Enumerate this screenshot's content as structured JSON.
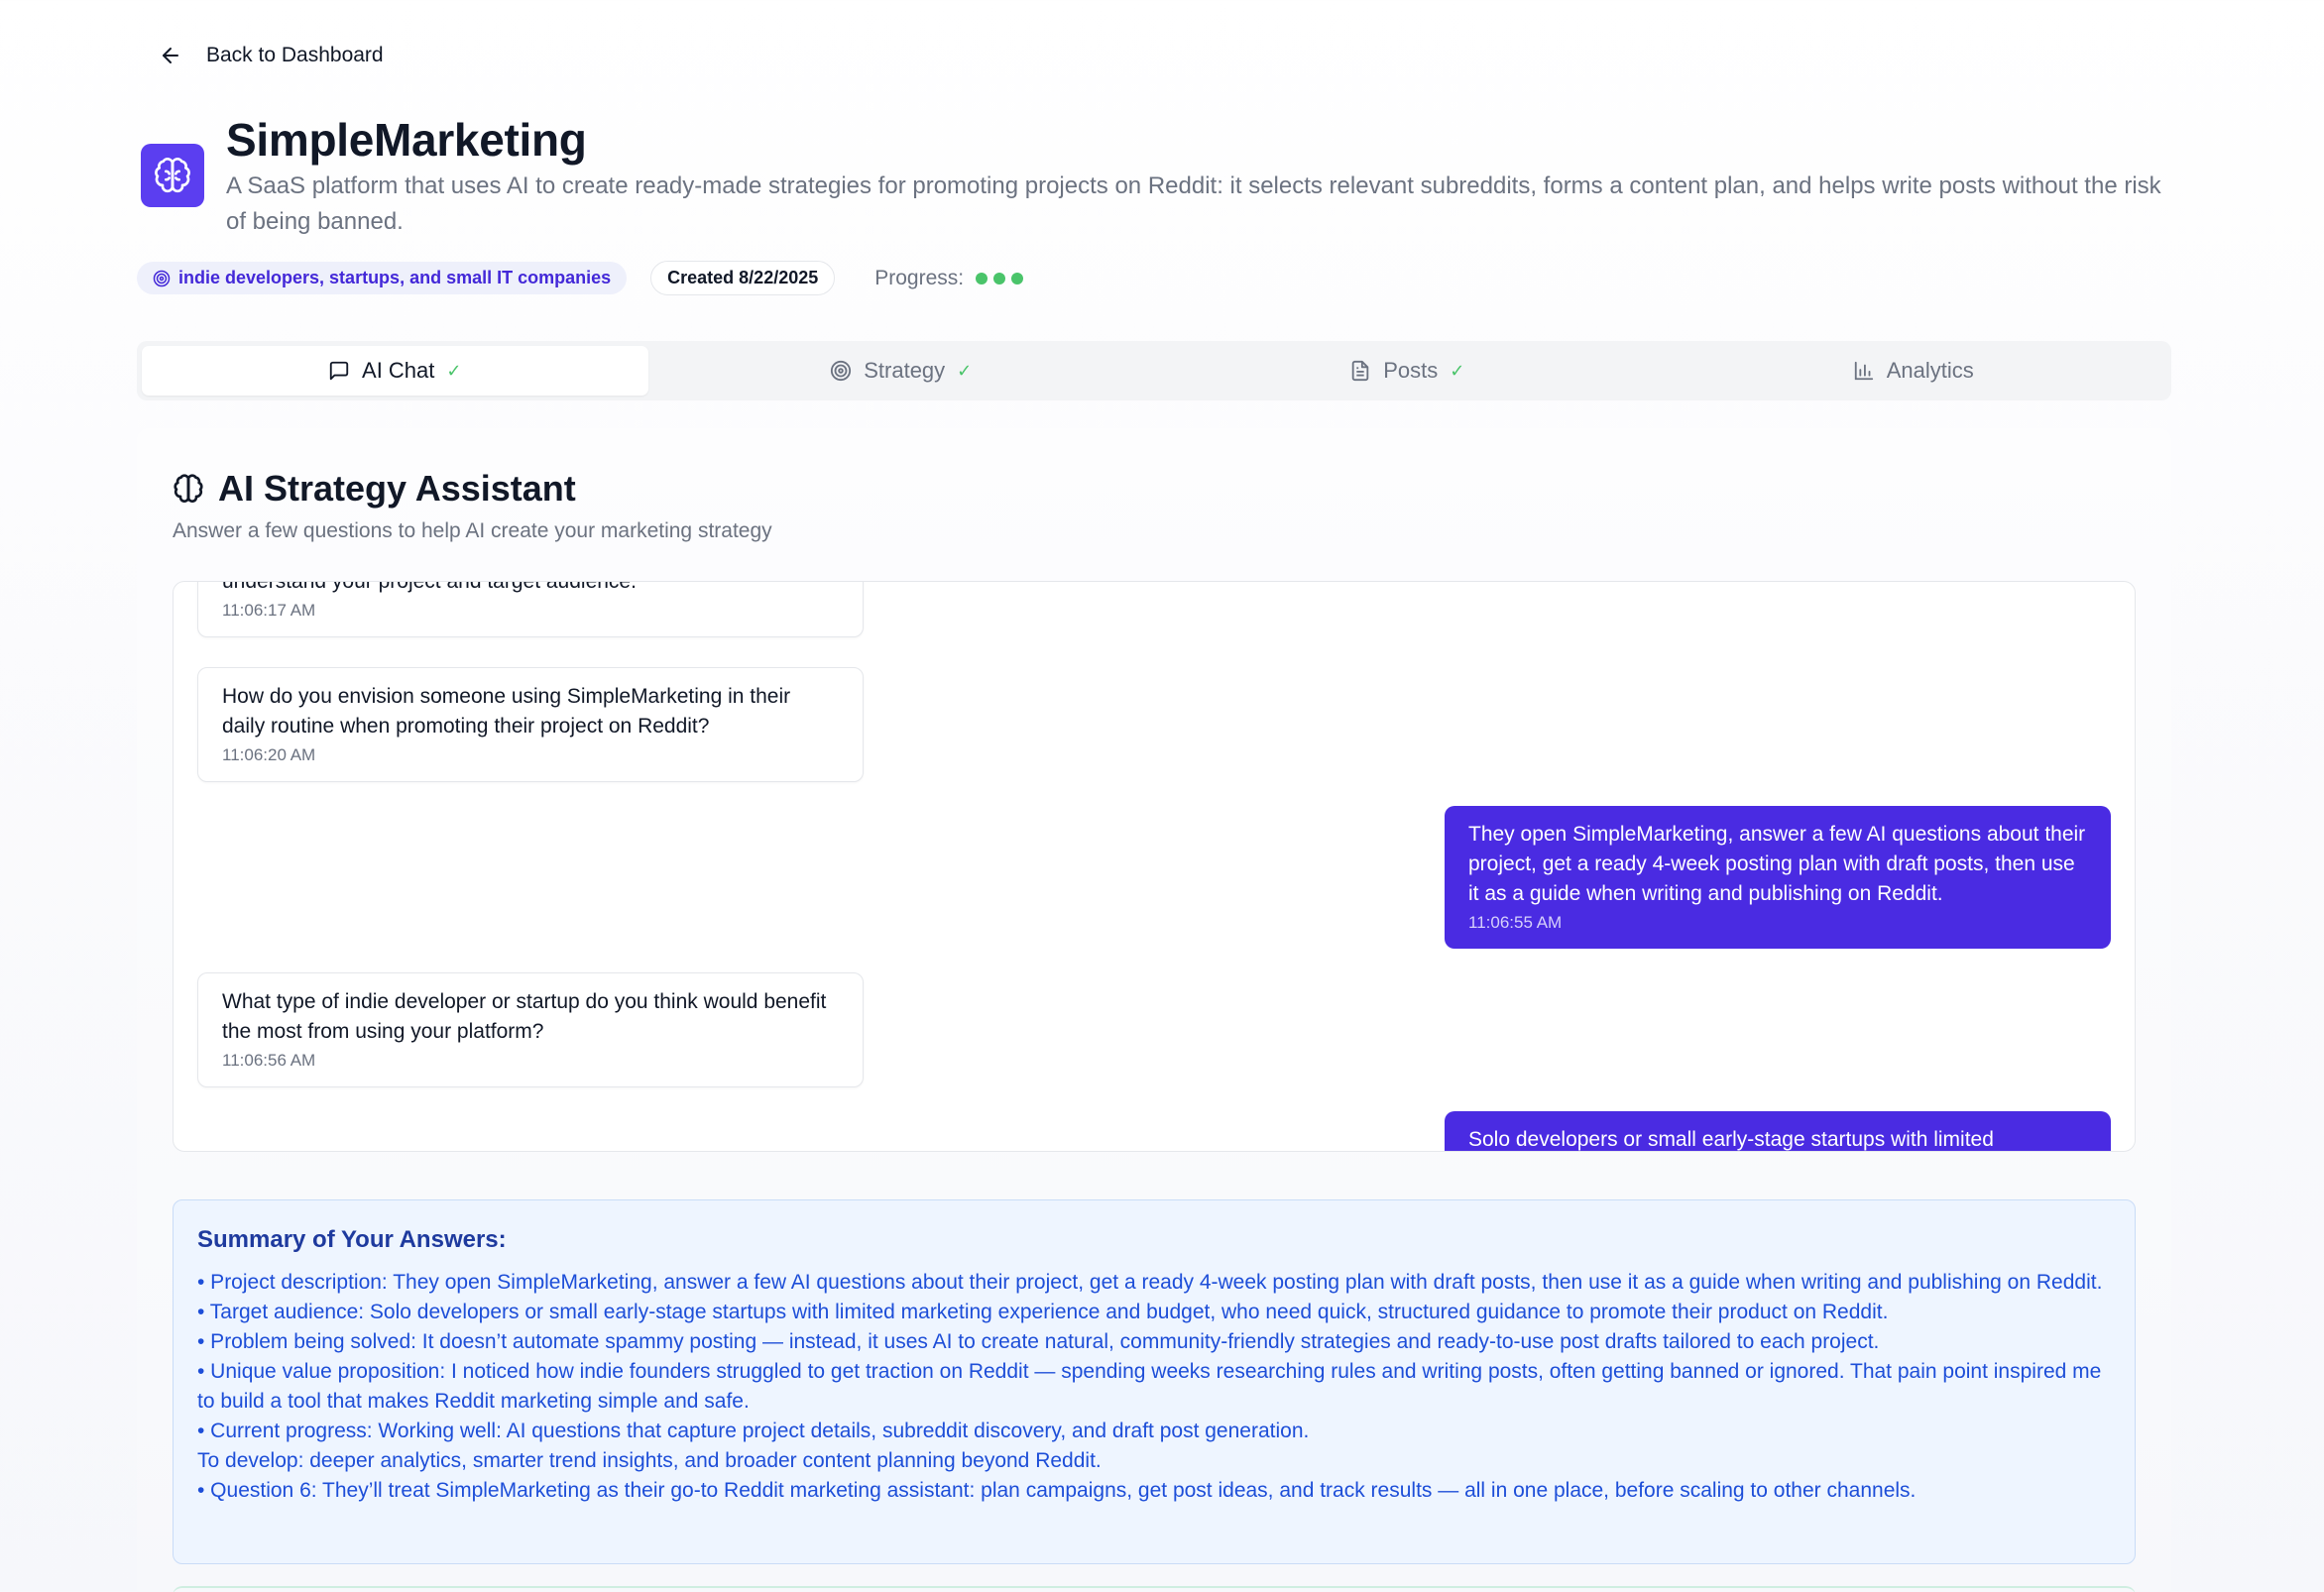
{
  "nav": {
    "back_label": "Back to Dashboard"
  },
  "project": {
    "title": "SimpleMarketing",
    "description": "A SaaS platform that uses AI to create ready-made strategies for promoting projects on Reddit: it selects relevant subreddits, forms a content plan, and helps write posts without the risk of being banned.",
    "audience": "indie developers, startups, and small IT companies",
    "created": "Created 8/22/2025",
    "progress_label": "Progress:",
    "progress_steps_completed": 3,
    "progress_color": "#4ac46a"
  },
  "tabs": [
    {
      "label": "AI Chat",
      "icon": "message-square-icon",
      "done": true,
      "active": true
    },
    {
      "label": "Strategy",
      "icon": "target-icon",
      "done": true,
      "active": false
    },
    {
      "label": "Posts",
      "icon": "file-text-icon",
      "done": true,
      "active": false
    },
    {
      "label": "Analytics",
      "icon": "bar-chart-icon",
      "done": false,
      "active": false
    }
  ],
  "assistant": {
    "title": "AI Strategy Assistant",
    "subtitle": "Answer a few questions to help AI create your marketing strategy"
  },
  "messages": [
    {
      "role": "ai",
      "text": "understand your project and target audience.",
      "time": "11:06:17 AM"
    },
    {
      "role": "ai",
      "text": "How do you envision someone using SimpleMarketing in their daily routine when promoting their project on Reddit?",
      "time": "11:06:20 AM"
    },
    {
      "role": "user",
      "text": "They open SimpleMarketing, answer a few AI questions about their project, get a ready 4-week posting plan with draft posts, then use it as a guide when writing and publishing on Reddit.",
      "time": "11:06:55 AM"
    },
    {
      "role": "ai",
      "text": "What type of indie developer or startup do you think would benefit the most from using your platform?",
      "time": "11:06:56 AM"
    },
    {
      "role": "user",
      "text": "Solo developers or small early-stage startups with limited",
      "time": ""
    }
  ],
  "summary": {
    "title": "Summary of Your Answers:",
    "lines": [
      "• Project description: They open SimpleMarketing, answer a few AI questions about their project, get a ready 4-week posting plan with draft posts, then use it as a guide when writing and publishing on Reddit.",
      "• Target audience: Solo developers or small early-stage startups with limited marketing experience and budget, who need quick, structured guidance to promote their product on Reddit.",
      "• Problem being solved: It doesn’t automate spammy posting — instead, it uses AI to create natural, community-friendly strategies and ready-to-use post drafts tailored to each project.",
      "• Unique value proposition: I noticed how indie founders struggled to get traction on Reddit — spending weeks researching rules and writing posts, often getting banned or ignored. That pain point inspired me to build a tool that makes Reddit marketing simple and safe.",
      "• Current progress: Working well: AI questions that capture project details, subreddit discovery, and draft post generation.",
      "To develop: deeper analytics, smarter trend insights, and broader content planning beyond Reddit.",
      "• Question 6: They’ll treat SimpleMarketing as their go-to Reddit marketing assistant: plan campaigns, get post ideas, and track results — all in one place, before scaling to other channels."
    ]
  },
  "colors": {
    "accent": "#4a2be2",
    "icon_bg": "#5b3ef0",
    "check": "#4ac46a"
  }
}
